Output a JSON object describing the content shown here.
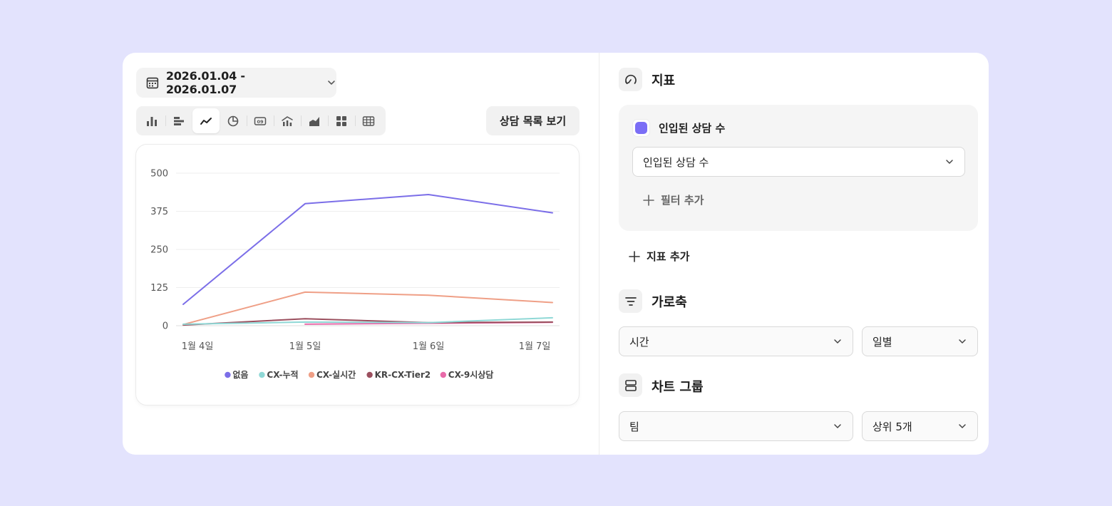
{
  "date_range": {
    "label": "2026.01.04 - 2026.01.07"
  },
  "toolbar": {
    "chart_types": [
      {
        "icon": "bar-chart-icon",
        "active": false
      },
      {
        "icon": "horizontal-bar-icon",
        "active": false
      },
      {
        "icon": "line-chart-icon",
        "active": true
      },
      {
        "icon": "pie-chart-icon",
        "active": false
      },
      {
        "icon": "number-card-icon",
        "active": false
      },
      {
        "icon": "combo-chart-icon",
        "active": false
      },
      {
        "icon": "area-chart-icon",
        "active": false
      },
      {
        "icon": "grid-icon",
        "active": false
      },
      {
        "icon": "table-icon",
        "active": false
      }
    ],
    "number_card_text": "09",
    "view_list_label": "상담 목록 보기"
  },
  "chart_data": {
    "type": "line",
    "x": [
      "1월 4일",
      "1월 5일",
      "1월 6일",
      "1월 7일"
    ],
    "yticks": [
      "500",
      "375",
      "250",
      "125",
      "0"
    ],
    "ylim": [
      0,
      500
    ],
    "grid": true,
    "legend_position": "bottom",
    "series": [
      {
        "name": "없음",
        "color": "#7b6ee8",
        "values": [
          70,
          400,
          430,
          370
        ]
      },
      {
        "name": "CX-누적",
        "color": "#8fd8d6",
        "values": [
          5,
          12,
          10,
          26
        ]
      },
      {
        "name": "CX-실시간",
        "color": "#ef9f86",
        "values": [
          4,
          110,
          100,
          76
        ]
      },
      {
        "name": "KR-CX-Tier2",
        "color": "#9b4f5e",
        "values": [
          2,
          23,
          10,
          12
        ]
      },
      {
        "name": "CX-9시상담",
        "color": "#e86aa9",
        "values": [
          null,
          5,
          8,
          11
        ]
      }
    ]
  },
  "metric": {
    "section_title": "지표",
    "item_label": "인입된 상담 수",
    "select_value": "인입된 상담 수",
    "add_filter_label": "필터 추가",
    "add_metric_label": "지표 추가",
    "accent_color": "#7b6ef6"
  },
  "x_axis": {
    "section_title": "가로축",
    "field_value": "시간",
    "interval_value": "일별"
  },
  "chart_group": {
    "section_title": "차트 그룹",
    "field_value": "팀",
    "limit_value": "상위 5개"
  }
}
